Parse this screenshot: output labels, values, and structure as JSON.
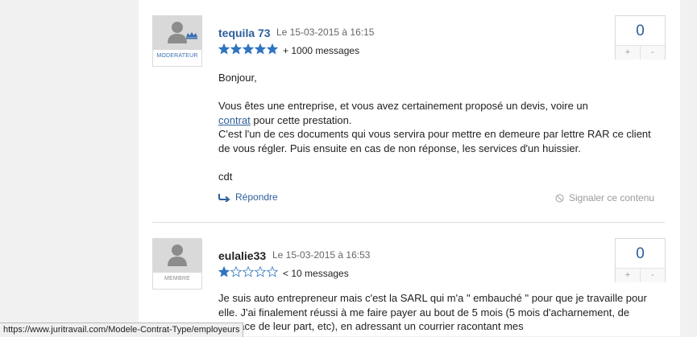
{
  "posts": [
    {
      "author": "tequila 73",
      "date": "Le 15-03-2015 à 16:15",
      "role": "MODERATEUR",
      "rating": 5,
      "message_count": "+ 1000 messages",
      "votes": "0",
      "vote_plus": "+",
      "vote_minus": "-",
      "body": {
        "greeting": "Bonjour,",
        "p1_before": "Vous êtes une entreprise, et vous avez certainement proposé un devis, voire un",
        "p1_link": "contrat",
        "p1_after": "pour cette prestation.",
        "p2": "C'est l'un de ces documents qui vous servira pour mettre en demeure par lettre RAR ce client de vous régler. Puis ensuite en cas de non réponse, les services d'un huissier.",
        "signoff": "cdt"
      },
      "reply_label": "Répondre",
      "report_label": "Signaler ce contenu"
    },
    {
      "author": "eulalie33",
      "date": "Le 15-03-2015 à 16:53",
      "role": "MEMBRE",
      "rating": 1,
      "message_count": "< 10 messages",
      "votes": "0",
      "vote_plus": "+",
      "vote_minus": "-",
      "body": {
        "text": "Je suis auto entrepreneur mais c'est la SARL qui m'a \" embauché \" pour que je travaille pour elle. J'ai finalement réussi à me faire payer au bout de 5 mois (5 mois d'acharnement, de menace de leur part, etc), en adressant un courrier racontant mes"
      }
    }
  ],
  "status_bar_url": "https://www.juritravail.com/Modele-Contrat-Type/employeurs",
  "colors": {
    "accent": "#2d5e9a",
    "star": "#2f74c0",
    "background": "#f1f1f1"
  }
}
